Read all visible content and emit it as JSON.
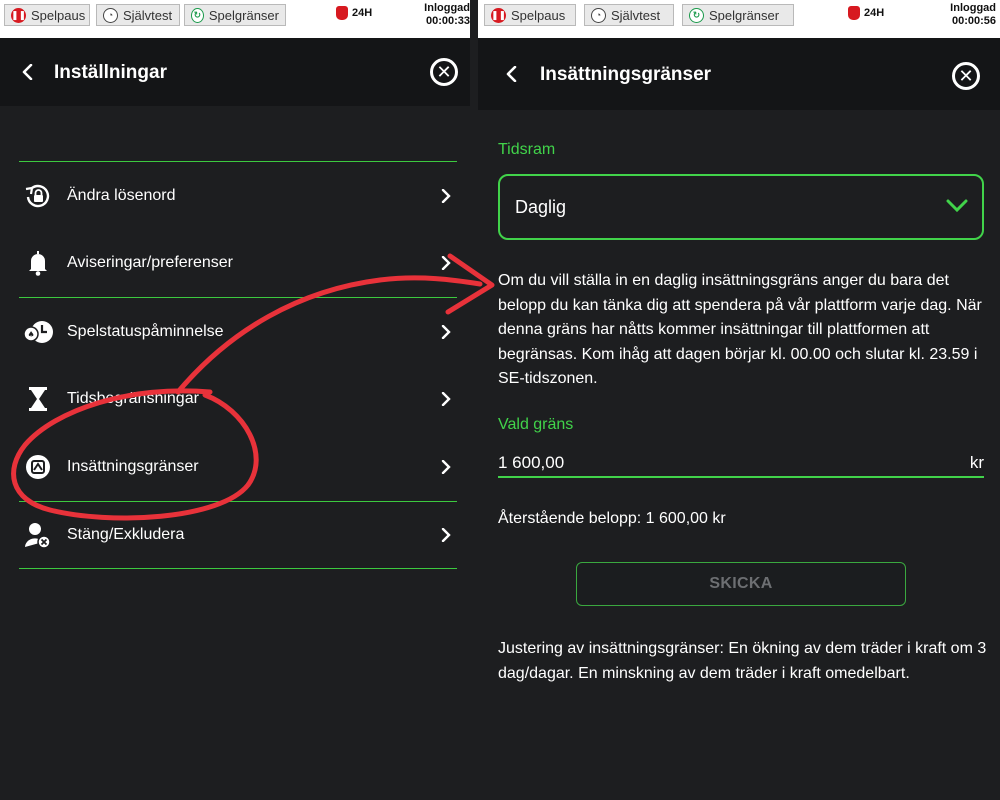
{
  "left_screen": {
    "topbar": {
      "pause_label": "Spelpaus",
      "selftest_label": "Självtest",
      "limits_label": "Spelgränser",
      "limit_24h": "24H",
      "login_label": "Inloggad",
      "login_time": "00:00:33"
    },
    "header": {
      "title": "Inställningar"
    },
    "menu": [
      {
        "label": "Ändra lösenord",
        "icon": "lock-reset-icon"
      },
      {
        "label": "Aviseringar/preferenser",
        "icon": "bell-icon"
      },
      {
        "label": "Spelstatuspåminnelse",
        "icon": "clock-status-icon"
      },
      {
        "label": "Tidsbegränsningar",
        "icon": "hourglass-icon"
      },
      {
        "label": "Insättningsgränser",
        "icon": "deposit-limit-icon"
      },
      {
        "label": "Stäng/Exkludera",
        "icon": "user-exclude-icon"
      }
    ]
  },
  "right_screen": {
    "topbar": {
      "pause_label": "Spelpaus",
      "selftest_label": "Självtest",
      "limits_label": "Spelgränser",
      "limit_24h": "24H",
      "login_label": "Inloggad",
      "login_time": "00:00:56"
    },
    "header": {
      "title": "Insättningsgränser"
    },
    "timeframe": {
      "label": "Tidsram",
      "value": "Daglig"
    },
    "description": "Om du vill ställa in en daglig insättningsgräns anger du bara det belopp du kan tänka dig att spendera på vår plattform varje dag. När denna gräns har nåtts kommer insättningar till plattformen att begränsas. Kom ihåg att dagen börjar kl. 00.00 och slutar kl. 23.59 i SE-tidszonen.",
    "chosen_limit": {
      "label": "Vald gräns",
      "value": "1 600,00",
      "currency": "kr"
    },
    "remaining": "Återstående belopp: 1 600,00 kr",
    "submit_label": "SKICKA",
    "adjust_note": "Justering av insättningsgränser: En ökning av dem träder i kraft om 3 dag/dagar. En minskning av dem träder i kraft omedelbart."
  },
  "colors": {
    "accent": "#41d34a",
    "background": "#1d1e20",
    "header": "#141517",
    "annotation": "#e8323a"
  }
}
